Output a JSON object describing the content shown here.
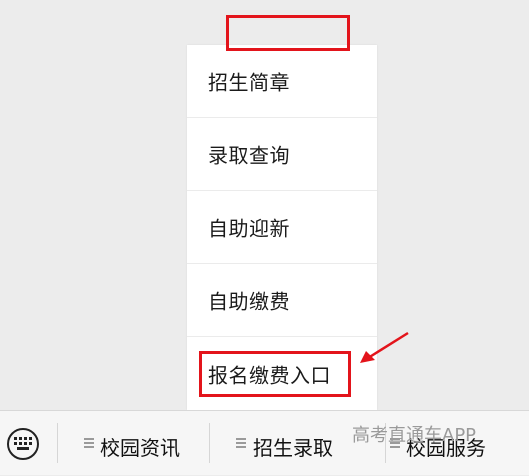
{
  "menu": {
    "items": [
      {
        "label": "招生简章"
      },
      {
        "label": "录取查询"
      },
      {
        "label": "自助迎新"
      },
      {
        "label": "自助缴费"
      },
      {
        "label": "报名缴费入口"
      }
    ]
  },
  "bottom_bar": {
    "keyboard_icon": "keyboard-icon",
    "tabs": [
      {
        "label": "校园资讯"
      },
      {
        "label": "招生录取"
      },
      {
        "label": "校园服务"
      }
    ]
  },
  "watermark": "高考直通车APP",
  "colors": {
    "highlight": "#e3141b",
    "background": "#ececec",
    "menu_bg": "#ffffff"
  }
}
